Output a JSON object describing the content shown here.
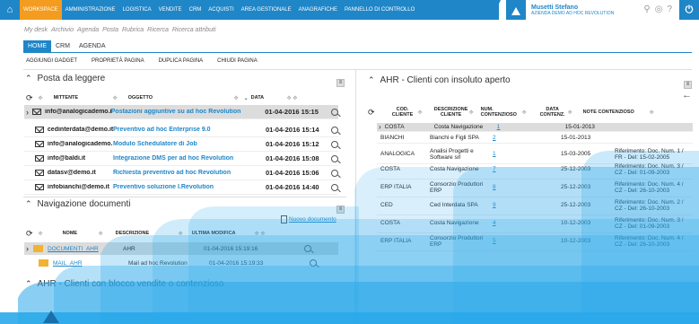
{
  "topbar": {
    "menu": [
      "WORKSPACE",
      "AMMINISTRAZIONE",
      "LOGISTICA",
      "VENDITE",
      "CRM",
      "ACQUISTI",
      "AREA GESTIONALE",
      "ANAGRAFICHE",
      "PANNELLO DI CONTROLLO"
    ],
    "user_name": "Musetti Stefano",
    "company": "AZIENDA DEMO AD HOC REVOLUTION"
  },
  "subnav": [
    "My desk",
    "Archivio",
    "Agenda",
    "Posta",
    "Rubrica",
    "Ricerca",
    "Ricerca attributi"
  ],
  "tabs": [
    "HOME",
    "CRM",
    "AGENDA"
  ],
  "toolbar": [
    "AGGIUNGI GADGET",
    "PROPRIETÀ PAGINA",
    "DUPLICA PAGINA",
    "CHIUDI PAGINA"
  ],
  "posta": {
    "title": "Posta da leggere",
    "headers": {
      "sender": "MITTENTE",
      "subject": "OGGETTO",
      "date": "DATA"
    },
    "rows": [
      {
        "sender": "info@analogicademo.it",
        "subject": "Postazioni aggiuntive su ad hoc Revolution",
        "date": "01-04-2016 15:15"
      },
      {
        "sender": "cedinterdata@demo.it",
        "subject": "Preventivo ad hoc Enterprise 9.0",
        "date": "01-04-2016 15:14"
      },
      {
        "sender": "info@analogicademo.it",
        "subject": "Modulo Schedulatore di Job",
        "date": "01-04-2016 15:12"
      },
      {
        "sender": "info@baldi.it",
        "subject": "Integrazione DMS per ad hoc Revolution",
        "date": "01-04-2016 15:08"
      },
      {
        "sender": "datasv@demo.it",
        "subject": "Richiesta preventivo ad hoc Revolution",
        "date": "01-04-2016 15:06"
      },
      {
        "sender": "infobianchi@demo.it",
        "subject": "Preventivo soluzione I.Revolution",
        "date": "01-04-2016 14:40"
      }
    ]
  },
  "docs": {
    "title": "Navigazione documenti",
    "new_doc": "Nuovo documento",
    "headers": {
      "name": "NOME",
      "desc": "DESCRIZIONE",
      "modified": "ULTIMA MODIFICA"
    },
    "rows": [
      {
        "name": "DOCUMENTI_AHR",
        "desc": "AHR",
        "modified": "01-04-2016 15:19:16"
      },
      {
        "name": "MAIL_AHR",
        "desc": "Mail ad hoc Revolution",
        "modified": "01-04-2016 15:19:33"
      }
    ]
  },
  "blocco": {
    "title": "AHR - Clienti con blocco vendite o contenzioso"
  },
  "insoluto": {
    "title": "AHR - Clienti con insoluto aperto",
    "headers": {
      "cod": "COD. CLIENTE",
      "desc": "DESCRIZIONE CLIENTE",
      "num": "NUM. CONTENZIOSO",
      "date": "DATA CONTENZ.",
      "note": "NOTE CONTENZIOSO"
    },
    "rows": [
      {
        "cod": "COSTA",
        "desc": "Costa Navigazione",
        "num": "1",
        "date": "15-01-2013",
        "note": ""
      },
      {
        "cod": "BIANCHI",
        "desc": "Bianchi e Figli SPA",
        "num": "2",
        "date": "15-01-2013",
        "note": ""
      },
      {
        "cod": "ANALOGICA",
        "desc": "Analisi Progetti e Software srl",
        "num": "1",
        "date": "15-03-2005",
        "note": "Riferimento: Doc. Num. 1 / FR - Del: 15-02-2005"
      },
      {
        "cod": "COSTA",
        "desc": "Costa Navigazione",
        "num": "7",
        "date": "25-12-2003",
        "note": "Riferimento: Doc. Num. 3 / CZ - Del: 01-09-2003"
      },
      {
        "cod": "ERP ITALIA",
        "desc": "Consorzio Produttori ERP",
        "num": "8",
        "date": "25-12-2003",
        "note": "Riferimento: Doc. Num. 4 / CZ - Del: 26-10-2003"
      },
      {
        "cod": "CED",
        "desc": "Ced Interdata SPA",
        "num": "9",
        "date": "25-12-2003",
        "note": "Riferimento: Doc. Num. 2 / CZ - Del: 26-10-2003"
      },
      {
        "cod": "COSTA",
        "desc": "Costa Navigazione",
        "num": "4",
        "date": "10-12-2003",
        "note": "Riferimento: Doc. Num. 3 / CZ - Del: 01-09-2003"
      },
      {
        "cod": "ERP ITALIA",
        "desc": "Consorzio Produttori ERP",
        "num": "5",
        "date": "10-12-2003",
        "note": "Riferimento: Doc. Num. 4 / CZ - Del: 26-10-2003"
      }
    ]
  },
  "colors": {
    "accent": "#1f86c8",
    "active_tab": "#f39c1f",
    "wave": "#2aa8ea"
  }
}
